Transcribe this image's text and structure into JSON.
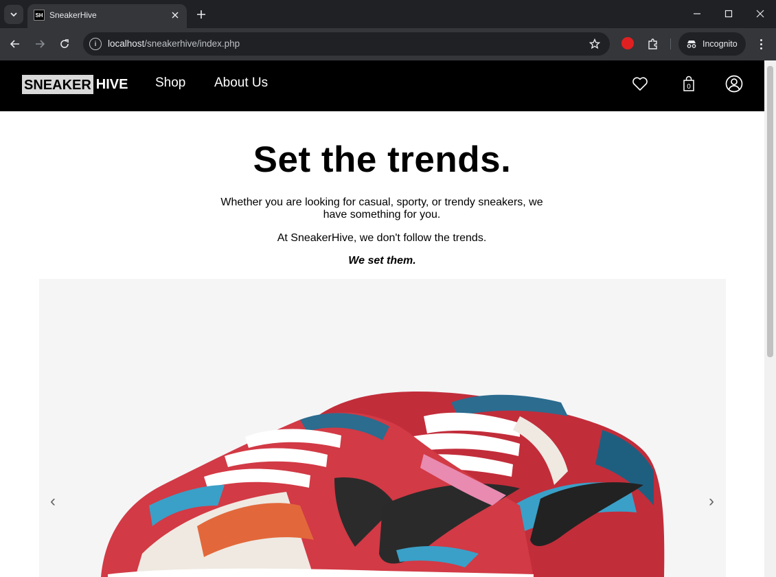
{
  "browser": {
    "tab_title": "SneakerHive",
    "favicon_text": "SH",
    "url_host": "localhost",
    "url_path": "/sneakerhive/index.php",
    "incognito_label": "Incognito"
  },
  "site": {
    "logo_part1": "SNEAKER",
    "logo_part2": "HIVE",
    "nav": [
      "Shop",
      "About Us"
    ],
    "cart_count": "0"
  },
  "hero": {
    "title": "Set the trends.",
    "line1": "Whether you are looking for casual, sporty, or trendy sneakers, we have something for you.",
    "line2": "At SneakerHive, we don't follow the trends.",
    "line3": "We set them."
  },
  "carousel": {
    "prev": "‹",
    "next": "›"
  },
  "colors": {
    "nav_bg": "#000000",
    "carousel_bg": "#f5f5f6",
    "chrome_dark": "#202124",
    "chrome_toolbar": "#35363a"
  }
}
